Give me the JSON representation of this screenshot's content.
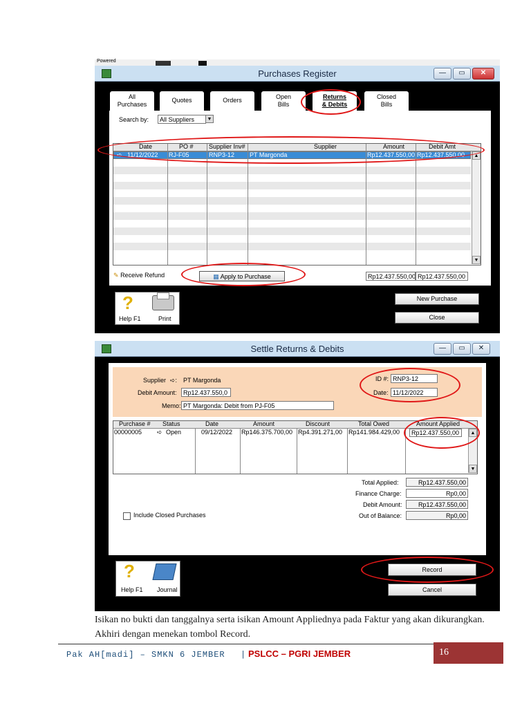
{
  "background_fragment": {
    "label": "Powered"
  },
  "purchases_register": {
    "title": "Purchases Register",
    "tabs": [
      {
        "label_line1": "All",
        "label_line2": "Purchases"
      },
      {
        "label_line1": "Quotes",
        "label_line2": ""
      },
      {
        "label_line1": "Orders",
        "label_line2": ""
      },
      {
        "label_line1": "Open",
        "label_line2": "Bills"
      },
      {
        "label_line1": "Returns",
        "label_line2": "& Debits"
      },
      {
        "label_line1": "Closed",
        "label_line2": "Bills"
      }
    ],
    "search_by_label": "Search by:",
    "search_by_value": "All Suppliers",
    "columns": [
      "Date",
      "PO #",
      "Supplier Inv#",
      "Supplier",
      "Amount",
      "Debit Amt"
    ],
    "row": {
      "arrow": "➪",
      "date": "11/12/2022",
      "po": "RJ-F05",
      "supplier_inv": "RNP3-12",
      "supplier": "PT Margonda",
      "amount": "Rp12.437.550,00",
      "debit_amt": "Rp12.437.550,00"
    },
    "receive_refund_label": "Receive Refund",
    "apply_to_purchase_label": "Apply to Purchase",
    "total_amount": "Rp12.437.550,00",
    "total_debit": "Rp12.437.550,00",
    "help_label": "Help F1",
    "print_label": "Print",
    "new_purchase_label": "New Purchase",
    "close_label": "Close"
  },
  "settle_returns": {
    "title": "Settle Returns & Debits",
    "supplier_label": "Supplier",
    "supplier_arrow": "➪:",
    "supplier_value": "PT Margonda",
    "debit_amount_label": "Debit Amount:",
    "debit_amount_value": "Rp12.437.550,0",
    "memo_label": "Memo:",
    "memo_value": "PT Margonda: Debit from PJ-F05",
    "id_label": "ID #:",
    "id_value": "RNP3-12",
    "date_label": "Date:",
    "date_value": "11/12/2022",
    "columns": [
      "Purchase #",
      "Status",
      "Date",
      "Amount",
      "Discount",
      "Total Owed",
      "Amount Applied"
    ],
    "row": {
      "purchase_no": "00000005",
      "status_arrow": "➪",
      "status": "Open",
      "date": "09/12/2022",
      "amount": "Rp146.375.700,00",
      "discount": "Rp4.391.271,00",
      "total_owed": "Rp141.984.429,00",
      "amount_applied": "Rp12.437.550,00"
    },
    "total_applied_label": "Total Applied:",
    "total_applied_value": "Rp12.437.550,00",
    "finance_charge_label": "Finance Charge:",
    "finance_charge_value": "Rp0,00",
    "debit_amount_total_label": "Debit Amount:",
    "debit_amount_total_value": "Rp12.437.550,00",
    "out_of_balance_label": "Out of Balance:",
    "out_of_balance_value": "Rp0,00",
    "include_closed_label": "Include Closed Purchases",
    "help_label": "Help F1",
    "journal_label": "Journal",
    "record_label": "Record",
    "cancel_label": "Cancel"
  },
  "caption": "Isikan no bukti dan tanggalnya serta isikan Amount Appliednya pada Faktur yang akan dikurangkan. Akhiri dengan menekan tombol Record.",
  "footer": {
    "author": "Pak AH[madi] – SMKN 6 JEMBER",
    "separator": "|",
    "org": "PSLCC – PGRI JEMBER",
    "page_number": "16"
  },
  "colors": {
    "window_frame": "#000000",
    "titlebar": "#cbe0f2",
    "selected_row": "#3a8cd6",
    "info_area": "#fad7b8",
    "annotation": "#e01818",
    "page_box": "#9c3434",
    "footer_text": "#1f4f7a"
  }
}
